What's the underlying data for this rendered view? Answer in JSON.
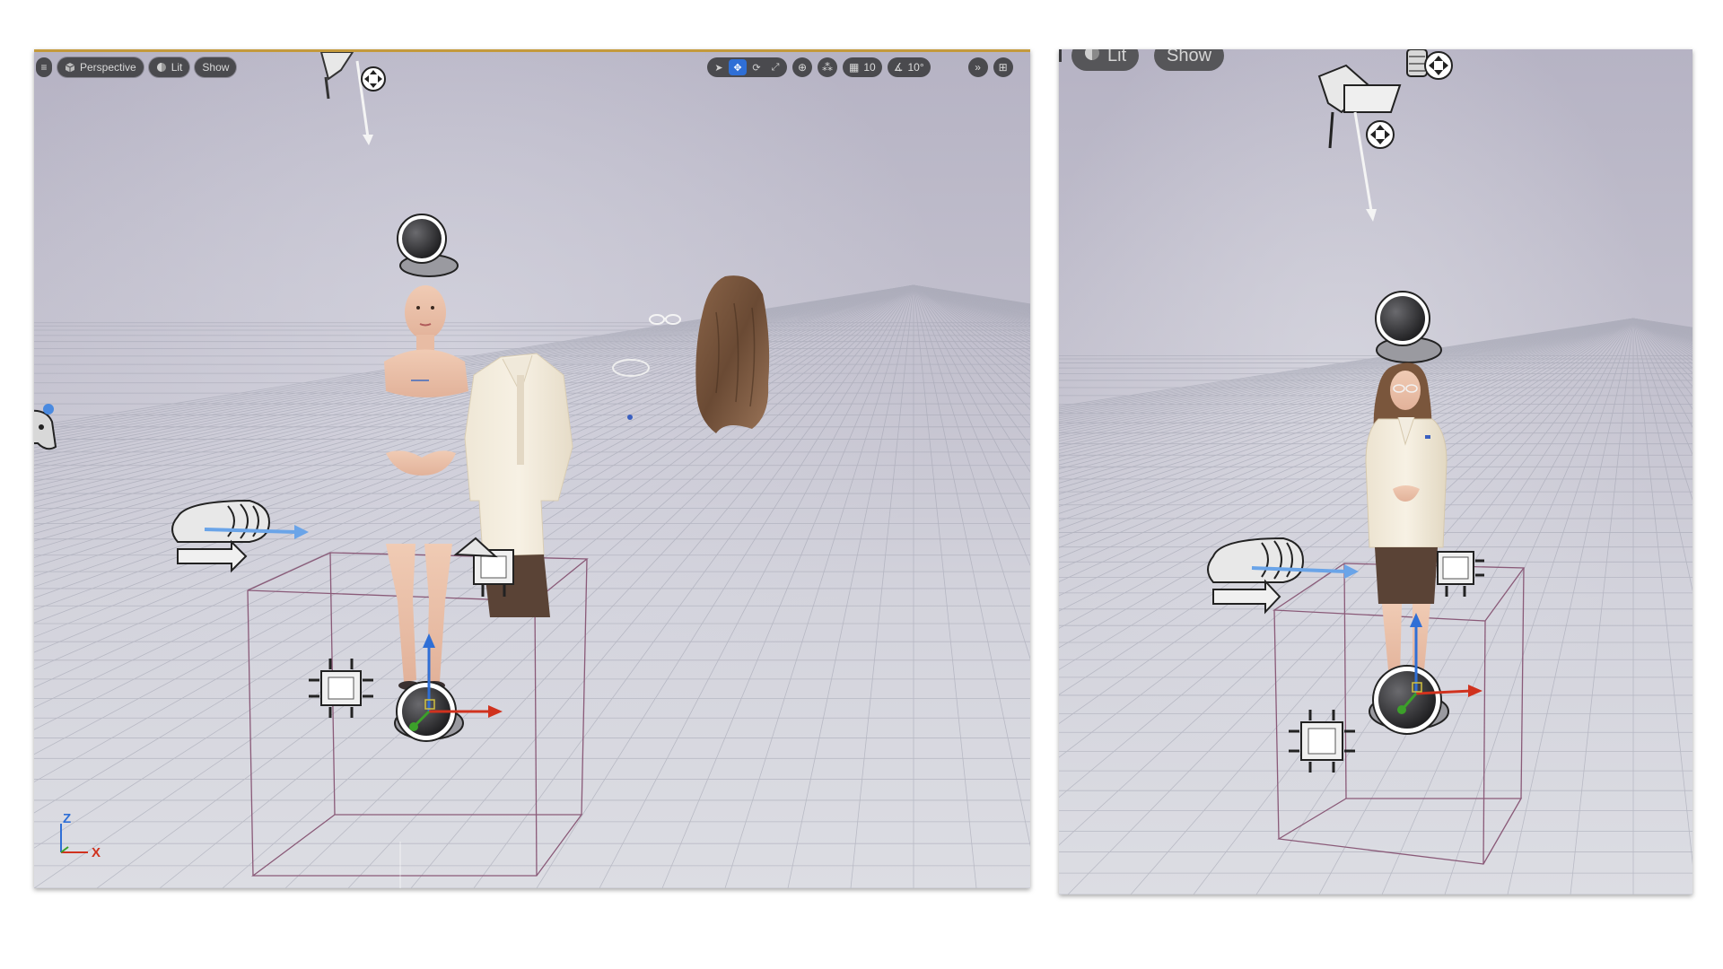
{
  "left_viewport": {
    "toolbar": {
      "view_mode": "Perspective",
      "lighting": "Lit",
      "show": "Show",
      "grid_snap": "10",
      "rotation_snap": "10°"
    },
    "axis": {
      "z": "Z",
      "x": "X"
    }
  },
  "right_viewport": {
    "toolbar": {
      "lighting": "Lit",
      "show": "Show"
    }
  },
  "colors": {
    "toolbar_bg": "#4a4a4e",
    "active_tool": "#2f6fd6",
    "gizmo_x": "#d0321e",
    "gizmo_y": "#3ca02a",
    "gizmo_z": "#2f6fd6",
    "bounds_box": "#8a5a78",
    "viewport_top_border": "#c49a3c"
  }
}
